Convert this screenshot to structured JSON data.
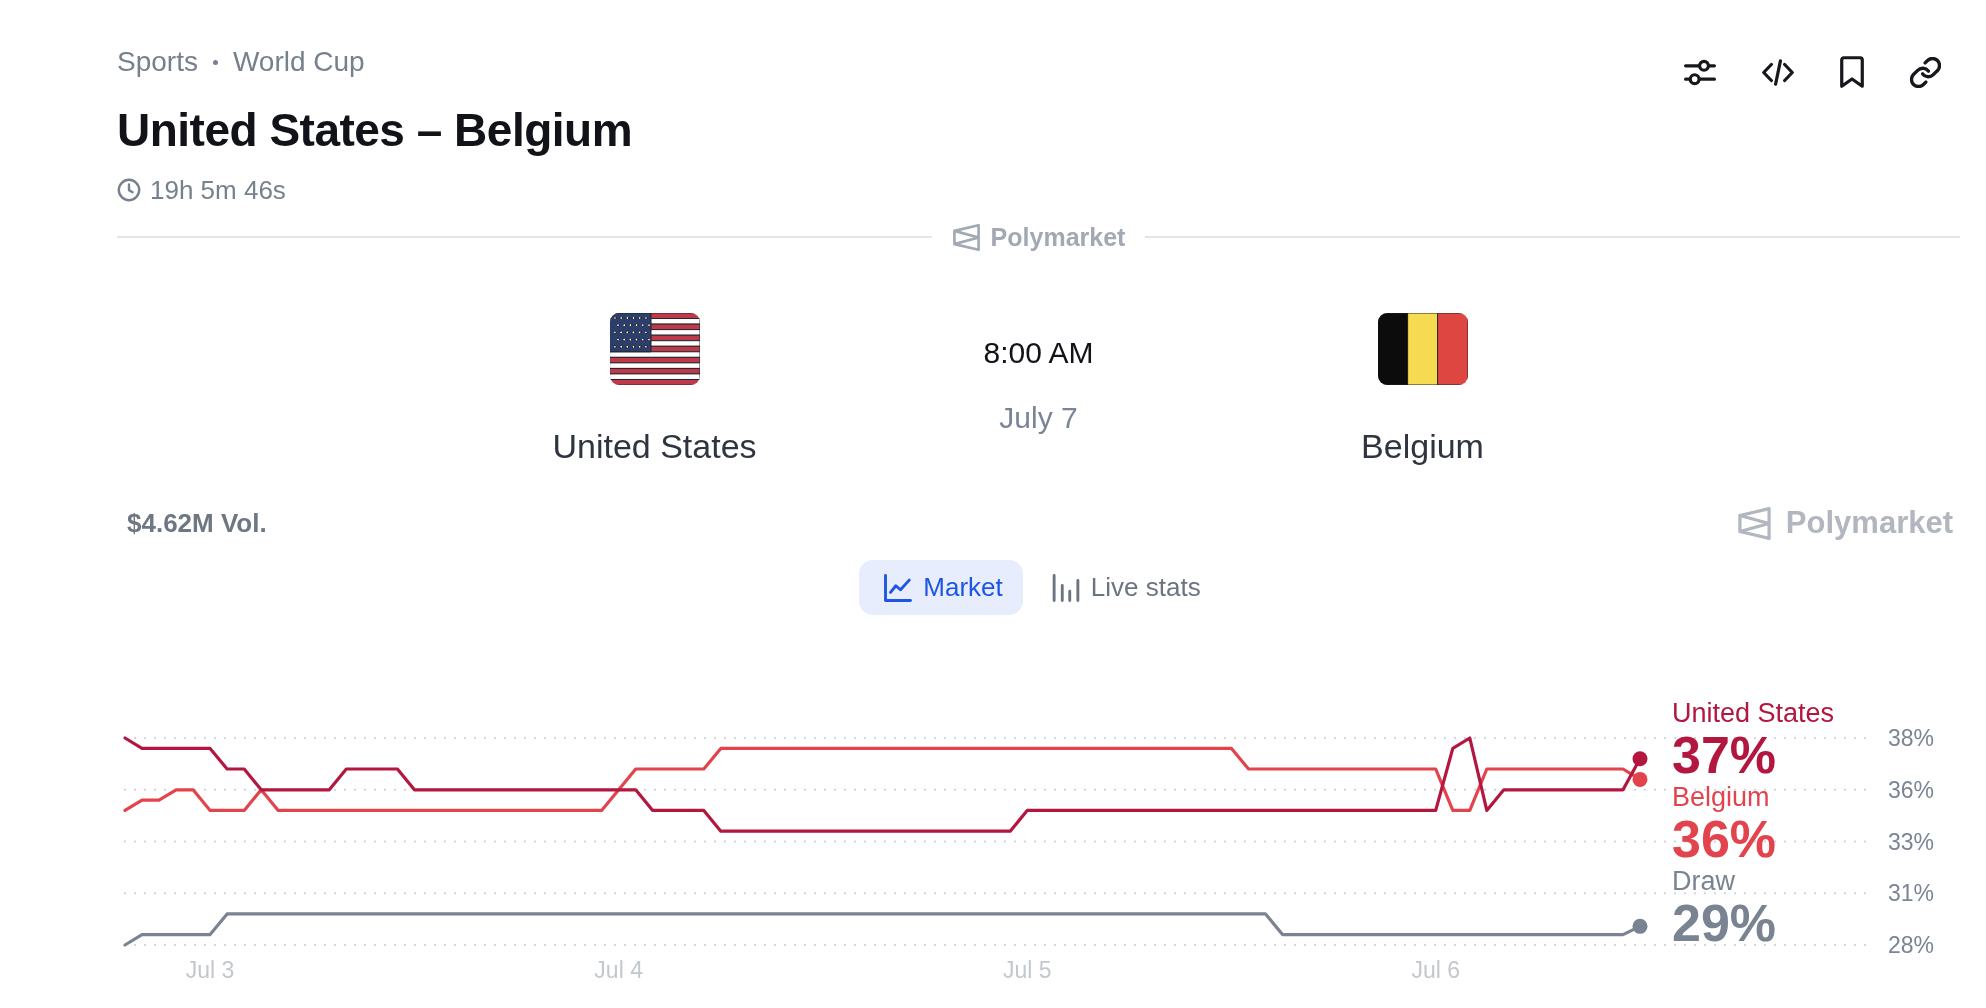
{
  "header": {
    "breadcrumb": [
      "Sports",
      "World Cup"
    ],
    "title": "United States – Belgium",
    "countdown": "19h 5m 46s"
  },
  "divider_brand": "Polymarket",
  "match": {
    "teams": [
      {
        "name": "United States"
      },
      {
        "name": "Belgium"
      }
    ],
    "time": "8:00 AM",
    "date": "July 7"
  },
  "market": {
    "volume": "$4.62M Vol.",
    "brand": "Polymarket",
    "tabs": [
      {
        "label": "Market",
        "selected": true
      },
      {
        "label": "Live stats",
        "selected": false
      }
    ],
    "chart": {
      "latest": [
        "37%",
        "36%",
        "29%"
      ],
      "chart_data": {
        "type": "line",
        "grid": true,
        "categories": [
          null,
          null,
          null,
          null,
          null,
          "Jul 3",
          null,
          null,
          null,
          null,
          null,
          null,
          null,
          null,
          null,
          null,
          null,
          null,
          null,
          null,
          null,
          null,
          null,
          null,
          null,
          null,
          null,
          null,
          null,
          "Jul 4",
          null,
          null,
          null,
          null,
          null,
          null,
          null,
          null,
          null,
          null,
          null,
          null,
          null,
          null,
          null,
          null,
          null,
          null,
          null,
          null,
          null,
          null,
          null,
          "Jul 5",
          null,
          null,
          null,
          null,
          null,
          null,
          null,
          null,
          null,
          null,
          null,
          null,
          null,
          null,
          null,
          null,
          null,
          null,
          null,
          null,
          null,
          null,
          null,
          "Jul 6",
          null,
          null,
          null,
          null,
          null,
          null,
          null,
          null,
          null,
          null,
          null,
          null
        ],
        "ylim": [
          28,
          38
        ],
        "yticks": [
          {
            "value": 28,
            "label": "28%"
          },
          {
            "value": 30.5,
            "label": "31%"
          },
          {
            "value": 33,
            "label": "33%"
          },
          {
            "value": 35.5,
            "label": "36%"
          },
          {
            "value": 38,
            "label": "38%"
          }
        ],
        "series": [
          {
            "name": "United States",
            "color": "#b3173f",
            "values": [
              38.0,
              37.5,
              37.5,
              37.5,
              37.5,
              37.5,
              36.5,
              36.5,
              35.5,
              35.5,
              35.5,
              35.5,
              35.5,
              36.5,
              36.5,
              36.5,
              36.5,
              35.5,
              35.5,
              35.5,
              35.5,
              35.5,
              35.5,
              35.5,
              35.5,
              35.5,
              35.5,
              35.5,
              35.5,
              35.5,
              35.5,
              34.5,
              34.5,
              34.5,
              34.5,
              33.5,
              33.5,
              33.5,
              33.5,
              33.5,
              33.5,
              33.5,
              33.5,
              33.5,
              33.5,
              33.5,
              33.5,
              33.5,
              33.5,
              33.5,
              33.5,
              33.5,
              33.5,
              34.5,
              34.5,
              34.5,
              34.5,
              34.5,
              34.5,
              34.5,
              34.5,
              34.5,
              34.5,
              34.5,
              34.5,
              34.5,
              34.5,
              34.5,
              34.5,
              34.5,
              34.5,
              34.5,
              34.5,
              34.5,
              34.5,
              34.5,
              34.5,
              34.5,
              37.5,
              38.0,
              34.5,
              35.5,
              35.5,
              35.5,
              35.5,
              35.5,
              35.5,
              35.5,
              35.5,
              37.0
            ]
          },
          {
            "name": "Belgium",
            "color": "#e3434c",
            "values": [
              34.5,
              35.0,
              35.0,
              35.5,
              35.5,
              34.5,
              34.5,
              34.5,
              35.5,
              34.5,
              34.5,
              34.5,
              34.5,
              34.5,
              34.5,
              34.5,
              34.5,
              34.5,
              34.5,
              34.5,
              34.5,
              34.5,
              34.5,
              34.5,
              34.5,
              34.5,
              34.5,
              34.5,
              34.5,
              35.5,
              36.5,
              36.5,
              36.5,
              36.5,
              36.5,
              37.5,
              37.5,
              37.5,
              37.5,
              37.5,
              37.5,
              37.5,
              37.5,
              37.5,
              37.5,
              37.5,
              37.5,
              37.5,
              37.5,
              37.5,
              37.5,
              37.5,
              37.5,
              37.5,
              37.5,
              37.5,
              37.5,
              37.5,
              37.5,
              37.5,
              37.5,
              37.5,
              37.5,
              37.5,
              37.5,
              37.5,
              36.5,
              36.5,
              36.5,
              36.5,
              36.5,
              36.5,
              36.5,
              36.5,
              36.5,
              36.5,
              36.5,
              36.5,
              34.5,
              34.5,
              36.5,
              36.5,
              36.5,
              36.5,
              36.5,
              36.5,
              36.5,
              36.5,
              36.5,
              36.0
            ]
          },
          {
            "name": "Draw",
            "color": "#7a8391",
            "values": [
              28.0,
              28.5,
              28.5,
              28.5,
              28.5,
              28.5,
              29.5,
              29.5,
              29.5,
              29.5,
              29.5,
              29.5,
              29.5,
              29.5,
              29.5,
              29.5,
              29.5,
              29.5,
              29.5,
              29.5,
              29.5,
              29.5,
              29.5,
              29.5,
              29.5,
              29.5,
              29.5,
              29.5,
              29.5,
              29.5,
              29.5,
              29.5,
              29.5,
              29.5,
              29.5,
              29.5,
              29.5,
              29.5,
              29.5,
              29.5,
              29.5,
              29.5,
              29.5,
              29.5,
              29.5,
              29.5,
              29.5,
              29.5,
              29.5,
              29.5,
              29.5,
              29.5,
              29.5,
              29.5,
              29.5,
              29.5,
              29.5,
              29.5,
              29.5,
              29.5,
              29.5,
              29.5,
              29.5,
              29.5,
              29.5,
              29.5,
              29.5,
              29.5,
              28.5,
              28.5,
              28.5,
              28.5,
              28.5,
              28.5,
              28.5,
              28.5,
              28.5,
              28.5,
              28.5,
              28.5,
              28.5,
              28.5,
              28.5,
              28.5,
              28.5,
              28.5,
              28.5,
              28.5,
              28.5,
              28.9
            ]
          }
        ]
      }
    }
  }
}
